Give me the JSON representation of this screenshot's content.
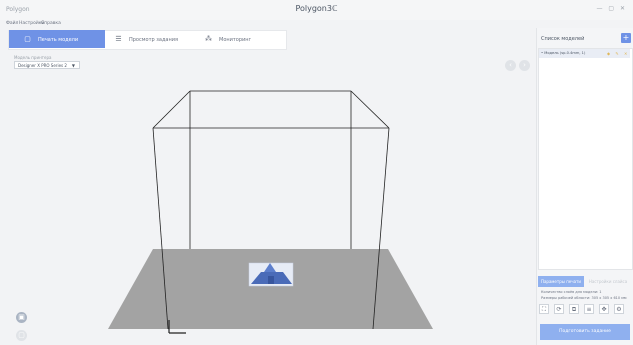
{
  "app": {
    "name": "Polygon",
    "title": "Polygon3ℂ",
    "controls": "—  ▢  ✕"
  },
  "menu": [
    {
      "label": "Файл"
    },
    {
      "label": "Настройки"
    },
    {
      "label": "Справка"
    }
  ],
  "tabs": [
    {
      "label": "Печать модели",
      "icon": "cube-outline-icon",
      "glyph": "▢",
      "active": true
    },
    {
      "label": "Просмотр задания",
      "icon": "layers-icon",
      "glyph": "☰",
      "active": false
    },
    {
      "label": "Мониторинг",
      "icon": "monitor-icon",
      "glyph": "⁂",
      "active": false
    }
  ],
  "model_select": {
    "label": "Модель принтера",
    "value": "Designer X PRO Series 2"
  },
  "viewport": {
    "nav_prev": "‹",
    "nav_next": "›",
    "btn1": "▣",
    "btn2": "▢"
  },
  "models_panel": {
    "title": "Список моделей",
    "add": "+",
    "items": [
      {
        "name": "• Модель (sp-0.4mm, 1)",
        "icons": "◆ ✎ ✕"
      }
    ]
  },
  "bottom_tabs": [
    {
      "label": "Параметры печати"
    },
    {
      "label": "Настройки слайса"
    }
  ],
  "info_lines": [
    "Количество слоёв для модели: 1",
    "Размеры рабочей области: 305 x 305 x 610 мм"
  ],
  "tools": [
    {
      "name": "fit-tool-icon",
      "glyph": "⛶"
    },
    {
      "name": "rotate-tool-icon",
      "glyph": "⟳"
    },
    {
      "name": "copy-tool-icon",
      "glyph": "⧉"
    },
    {
      "name": "layers-tool-icon",
      "glyph": "≡"
    },
    {
      "name": "move-tool-icon",
      "glyph": "✥"
    },
    {
      "name": "settings-tool-icon",
      "glyph": "⚙"
    }
  ],
  "prepare_button": "Подготовить задание",
  "colors": {
    "accent": "#6f92e6",
    "accent_light": "#8fb0ef",
    "bed": "#a3a3a3",
    "model": "#4a6bb8"
  }
}
